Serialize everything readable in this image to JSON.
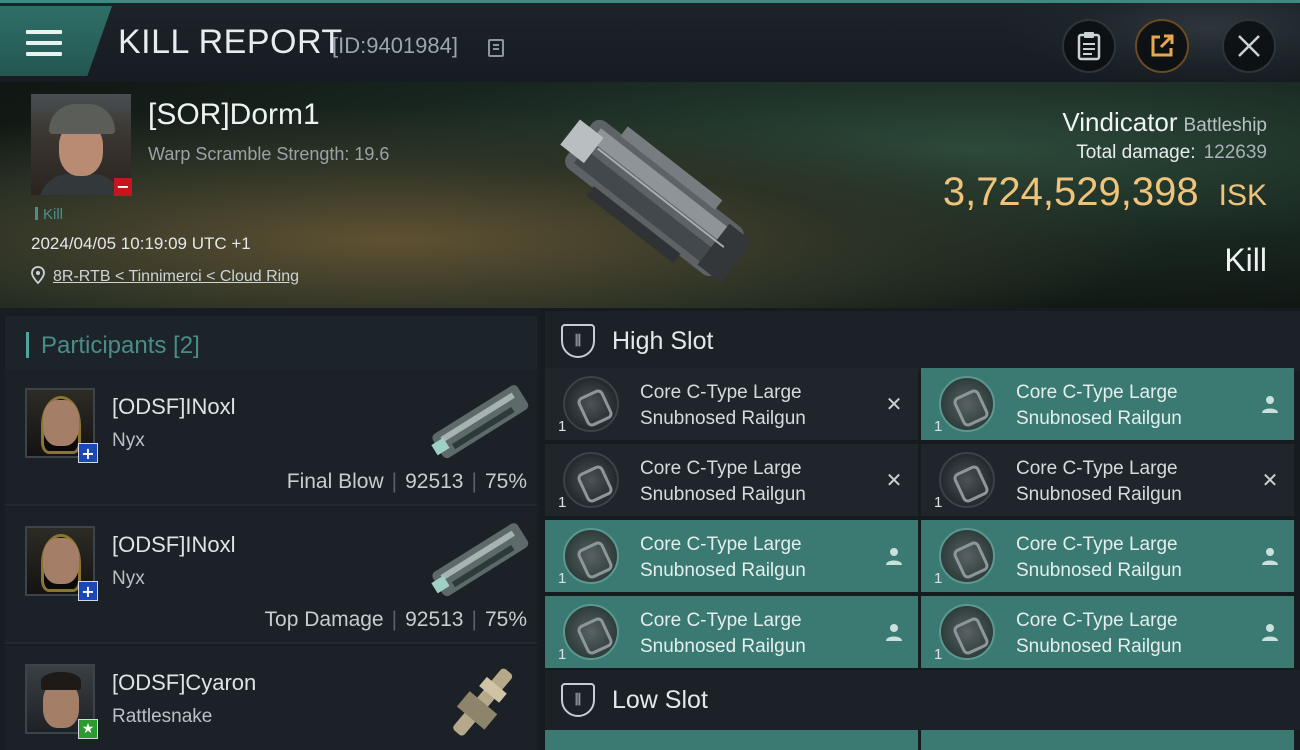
{
  "header": {
    "title": "KILL REPORT",
    "report_id": "[ID:9401984]"
  },
  "victim": {
    "name": "[SOR]Dorm1",
    "warp_scramble": "Warp Scramble Strength: 19.6",
    "tag": "Kill",
    "datetime": "2024/04/05 10:19:09 UTC +1",
    "location": "8R-RTB < Tinnimerci < Cloud Ring"
  },
  "ship": {
    "name": "Vindicator",
    "class": "Battleship",
    "total_damage_label": "Total damage:",
    "total_damage": "122639",
    "value": "3,724,529,398",
    "currency": "ISK",
    "result": "Kill"
  },
  "participants": {
    "title": "Participants [2]",
    "items": [
      {
        "name": "[ODSF]INoxl",
        "ship": "Nyx",
        "role": "Final Blow",
        "damage": "92513",
        "percent": "75%",
        "badge": "+"
      },
      {
        "name": "[ODSF]INoxl",
        "ship": "Nyx",
        "role": "Top Damage",
        "damage": "92513",
        "percent": "75%",
        "badge": "+"
      },
      {
        "name": "[ODSF]Cyaron",
        "ship": "Rattlesnake",
        "role": "",
        "damage": "",
        "percent": "",
        "badge": "★"
      }
    ]
  },
  "slots": {
    "high_slot_label": "High Slot",
    "low_slot_label": "Low Slot",
    "high_modules": [
      {
        "qty": "1",
        "line1": "Core C-Type Large",
        "line2": "Snubnosed Railgun",
        "status": "destroyed"
      },
      {
        "qty": "1",
        "line1": "Core C-Type Large",
        "line2": "Snubnosed Railgun",
        "status": "dropped"
      },
      {
        "qty": "1",
        "line1": "Core C-Type Large",
        "line2": "Snubnosed Railgun",
        "status": "destroyed"
      },
      {
        "qty": "1",
        "line1": "Core C-Type Large",
        "line2": "Snubnosed Railgun",
        "status": "destroyed"
      },
      {
        "qty": "1",
        "line1": "Core C-Type Large",
        "line2": "Snubnosed Railgun",
        "status": "dropped"
      },
      {
        "qty": "1",
        "line1": "Core C-Type Large",
        "line2": "Snubnosed Railgun",
        "status": "dropped"
      },
      {
        "qty": "1",
        "line1": "Core C-Type Large",
        "line2": "Snubnosed Railgun",
        "status": "dropped"
      },
      {
        "qty": "1",
        "line1": "Core C-Type Large",
        "line2": "Snubnosed Railgun",
        "status": "dropped"
      }
    ]
  },
  "colors": {
    "accent_teal": "#3a7a72",
    "isk_gold": "#efc47a",
    "victim_badge_red": "#c4161c"
  }
}
